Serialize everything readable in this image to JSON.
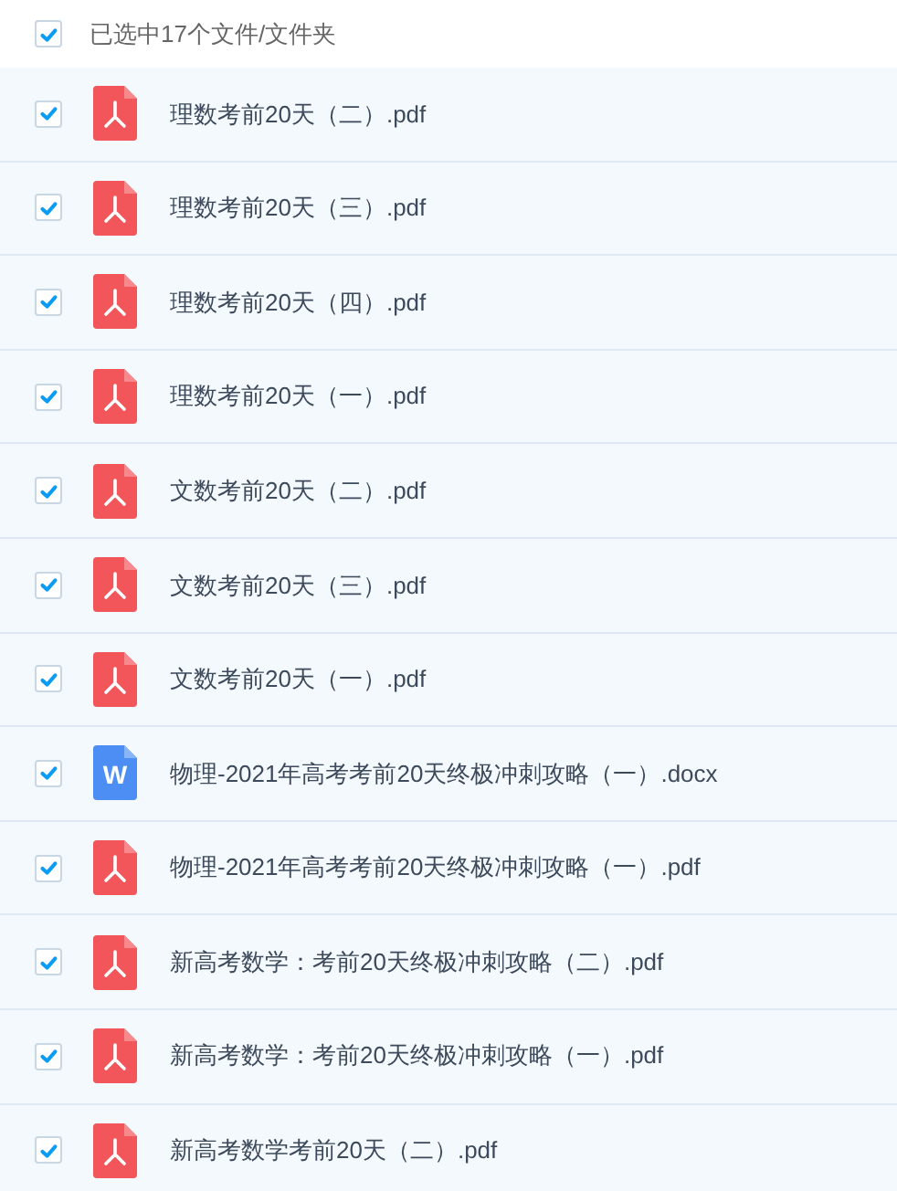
{
  "header": {
    "checked": true,
    "label": "已选中17个文件/文件夹"
  },
  "files": [
    {
      "name": "理数考前20天（二）.pdf",
      "kind": "pdf",
      "checked": true
    },
    {
      "name": "理数考前20天（三）.pdf",
      "kind": "pdf",
      "checked": true
    },
    {
      "name": "理数考前20天（四）.pdf",
      "kind": "pdf",
      "checked": true
    },
    {
      "name": "理数考前20天（一）.pdf",
      "kind": "pdf",
      "checked": true
    },
    {
      "name": "文数考前20天（二）.pdf",
      "kind": "pdf",
      "checked": true
    },
    {
      "name": "文数考前20天（三）.pdf",
      "kind": "pdf",
      "checked": true
    },
    {
      "name": "文数考前20天（一）.pdf",
      "kind": "pdf",
      "checked": true
    },
    {
      "name": "物理-2021年高考考前20天终极冲刺攻略（一）.docx",
      "kind": "docx",
      "icon_letter": "W",
      "checked": true
    },
    {
      "name": "物理-2021年高考考前20天终极冲刺攻略（一）.pdf",
      "kind": "pdf",
      "checked": true
    },
    {
      "name": "新高考数学：考前20天终极冲刺攻略（二）.pdf",
      "kind": "pdf",
      "checked": true
    },
    {
      "name": "新高考数学：考前20天终极冲刺攻略（一）.pdf",
      "kind": "pdf",
      "checked": true
    },
    {
      "name": "新高考数学考前20天（二）.pdf",
      "kind": "pdf",
      "checked": true
    }
  ]
}
